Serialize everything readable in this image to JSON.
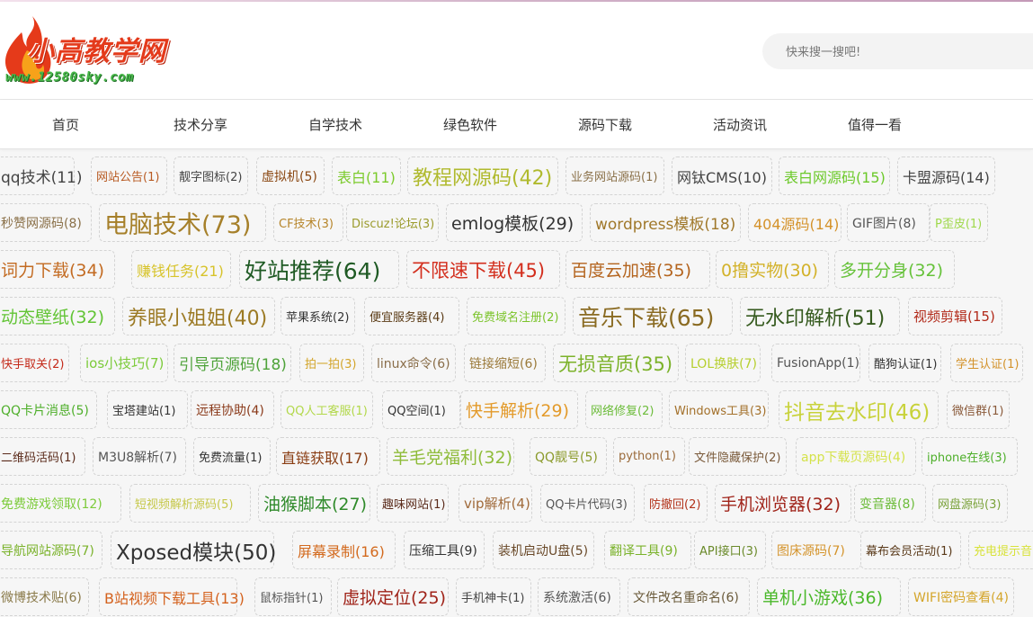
{
  "header": {
    "logo_text": "小高教学网",
    "logo_url": "www.12580sky.com",
    "search_placeholder": "快来搜一搜吧!"
  },
  "nav": [
    {
      "label": "首页"
    },
    {
      "label": "技术分享"
    },
    {
      "label": "自学技术"
    },
    {
      "label": "绿色软件"
    },
    {
      "label": "源码下载"
    },
    {
      "label": "活动资讯"
    },
    {
      "label": "值得一看"
    }
  ],
  "tag_rows": [
    [
      {
        "label": "qq技术(11)",
        "color": "#444444"
      },
      {
        "label": "网站公告(1)",
        "color": "#b85a22"
      },
      {
        "label": "靓字图标(2)",
        "color": "#444444"
      },
      {
        "label": "虚拟机(5)",
        "color": "#8a4712"
      },
      {
        "label": "表白(11)",
        "color": "#7ccb2c"
      },
      {
        "label": "教程网源码(42)",
        "color": "#b0ba2e"
      },
      {
        "label": "业务网站源码(1)",
        "color": "#8a7048"
      },
      {
        "label": "网钛CMS(10)",
        "color": "#444444"
      },
      {
        "label": "表白网源码(15)",
        "color": "#6cc92a"
      },
      {
        "label": "卡盟源码(14)",
        "color": "#444444"
      }
    ],
    [
      {
        "label": "秒赞网源码(8)",
        "color": "#8a7048"
      },
      {
        "label": "电脑技术(73)",
        "color": "#a6802a"
      },
      {
        "label": "CF技术(3)",
        "color": "#b6852a"
      },
      {
        "label": "Discuz!论坛(3)",
        "color": "#9b9b2c"
      },
      {
        "label": "emlog模板(29)",
        "color": "#333333"
      },
      {
        "label": "wordpress模板(18)",
        "color": "#a0782a"
      },
      {
        "label": "404源码(14)",
        "color": "#d4922a"
      },
      {
        "label": "GIF图片(8)",
        "color": "#555555"
      },
      {
        "label": "P歪皮(1)",
        "color": "#9fd84a"
      }
    ],
    [
      {
        "label": "词力下载(34)",
        "color": "#c36b22"
      },
      {
        "label": "赚钱任务(21)",
        "color": "#d7c32a"
      },
      {
        "label": "好站推荐(64)",
        "color": "#1f5a24"
      },
      {
        "label": "不限速下载(45)",
        "color": "#d32f1e"
      },
      {
        "label": "百度云加速(35)",
        "color": "#b4641e"
      },
      {
        "label": "0撸实物(30)",
        "color": "#d3b22a"
      },
      {
        "label": "多开分身(32)",
        "color": "#66c23a"
      }
    ],
    [
      {
        "label": "动态壁纸(32)",
        "color": "#62c435"
      },
      {
        "label": "养眼小姐姐(40)",
        "color": "#9c7a24"
      },
      {
        "label": "苹果系统(2)",
        "color": "#333333"
      },
      {
        "label": "便宜服务器(4)",
        "color": "#5a3a14"
      },
      {
        "label": "免费域名注册(2)",
        "color": "#7cc42c"
      },
      {
        "label": "音乐下载(65)",
        "color": "#8a6b22"
      },
      {
        "label": "无水印解析(51)",
        "color": "#355a1e"
      },
      {
        "label": "视频剪辑(15)",
        "color": "#b22a1a"
      }
    ],
    [
      {
        "label": "快手取关(2)",
        "color": "#c42a1a"
      },
      {
        "label": "ios小技巧(7)",
        "color": "#7ccb3a"
      },
      {
        "label": "引导页源码(18)",
        "color": "#4fa33a"
      },
      {
        "label": "拍一拍(3)",
        "color": "#d3a52a"
      },
      {
        "label": "linux命令(6)",
        "color": "#8a6e4a"
      },
      {
        "label": "链接缩短(6)",
        "color": "#9b7a3a"
      },
      {
        "label": "无损音质(35)",
        "color": "#7cb22a"
      },
      {
        "label": "LOL换肤(7)",
        "color": "#b6cf2e"
      },
      {
        "label": "FusionApp(1)",
        "color": "#555555"
      },
      {
        "label": "酷狗认证(1)",
        "color": "#333333"
      },
      {
        "label": "学生认证(1)",
        "color": "#d3922a"
      }
    ],
    [
      {
        "label": "QQ卡片消息(5)",
        "color": "#4eaf2a"
      },
      {
        "label": "宝塔建站(1)",
        "color": "#333333"
      },
      {
        "label": "远程协助(4)",
        "color": "#8a3a1a"
      },
      {
        "label": "QQ人工客服(1)",
        "color": "#b2d84a"
      },
      {
        "label": "QQ空间(1)",
        "color": "#333333"
      },
      {
        "label": "快手解析(29)",
        "color": "#e39a2a"
      },
      {
        "label": "网络修复(2)",
        "color": "#6cbc3a"
      },
      {
        "label": "Windows工具(3)",
        "color": "#a3702a"
      },
      {
        "label": "抖音去水印(46)",
        "color": "#c8d23a"
      },
      {
        "label": "微信群(1)",
        "color": "#8a5a3a"
      }
    ],
    [
      {
        "label": "二维码活码(1)",
        "color": "#5a2a1a"
      },
      {
        "label": "M3U8解析(7)",
        "color": "#555555"
      },
      {
        "label": "免费流量(1)",
        "color": "#333333"
      },
      {
        "label": "直链获取(17)",
        "color": "#8a3e14"
      },
      {
        "label": "羊毛党福利(32)",
        "color": "#8fbc3a"
      },
      {
        "label": "QQ靓号(5)",
        "color": "#8a9a2a"
      },
      {
        "label": "python(1)",
        "color": "#9a6a3a"
      },
      {
        "label": "文件隐藏保护(2)",
        "color": "#7a5a3a"
      },
      {
        "label": "app下载页源码(4)",
        "color": "#d4e24a"
      },
      {
        "label": "iphone在线(3)",
        "color": "#4eaf2a"
      }
    ],
    [
      {
        "label": "免费游戏领取(12)",
        "color": "#7ccb3a"
      },
      {
        "label": "短视频解析源码(5)",
        "color": "#c6c84a"
      },
      {
        "label": "油猴脚本(27)",
        "color": "#2f8a2a"
      },
      {
        "label": "趣味网站(1)",
        "color": "#5a2a1a"
      },
      {
        "label": "vip解析(4)",
        "color": "#a06a3a"
      },
      {
        "label": "QQ卡片代码(3)",
        "color": "#555555"
      },
      {
        "label": "防撤回(2)",
        "color": "#b2321a"
      },
      {
        "label": "手机浏览器(32)",
        "color": "#a0241a"
      },
      {
        "label": "变音器(8)",
        "color": "#6cbc3a"
      },
      {
        "label": "网盘源码(3)",
        "color": "#7aa23a"
      }
    ],
    [
      {
        "label": "导航网站源码(7)",
        "color": "#7ab22a"
      },
      {
        "label": "Xposed模块(50)",
        "color": "#333333"
      },
      {
        "label": "屏幕录制(16)",
        "color": "#d36a1e"
      },
      {
        "label": "压缩工具(9)",
        "color": "#333333"
      },
      {
        "label": "装机启动U盘(5)",
        "color": "#6a4a2a"
      },
      {
        "label": "翻译工具(9)",
        "color": "#7ab22a"
      },
      {
        "label": "API接口(3)",
        "color": "#6a8a2a"
      },
      {
        "label": "图床源码(7)",
        "color": "#d4932a"
      },
      {
        "label": "幕布会员活动(1)",
        "color": "#5a3a1a"
      },
      {
        "label": "充电提示音",
        "color": "#d8e23a"
      }
    ],
    [
      {
        "label": "微博技术贴(6)",
        "color": "#8a7a4a"
      },
      {
        "label": "B站视频下载工具(13)",
        "color": "#d4621e"
      },
      {
        "label": "鼠标指针(1)",
        "color": "#555555"
      },
      {
        "label": "虚拟定位(25)",
        "color": "#a0241a"
      },
      {
        "label": "手机神卡(1)",
        "color": "#444444"
      },
      {
        "label": "系统激活(6)",
        "color": "#555555"
      },
      {
        "label": "文件改名重命名(6)",
        "color": "#6a5a3a"
      },
      {
        "label": "单机小游戏(36)",
        "color": "#4ab82a"
      },
      {
        "label": "WIFI密码查看(4)",
        "color": "#d4a52a"
      }
    ]
  ]
}
